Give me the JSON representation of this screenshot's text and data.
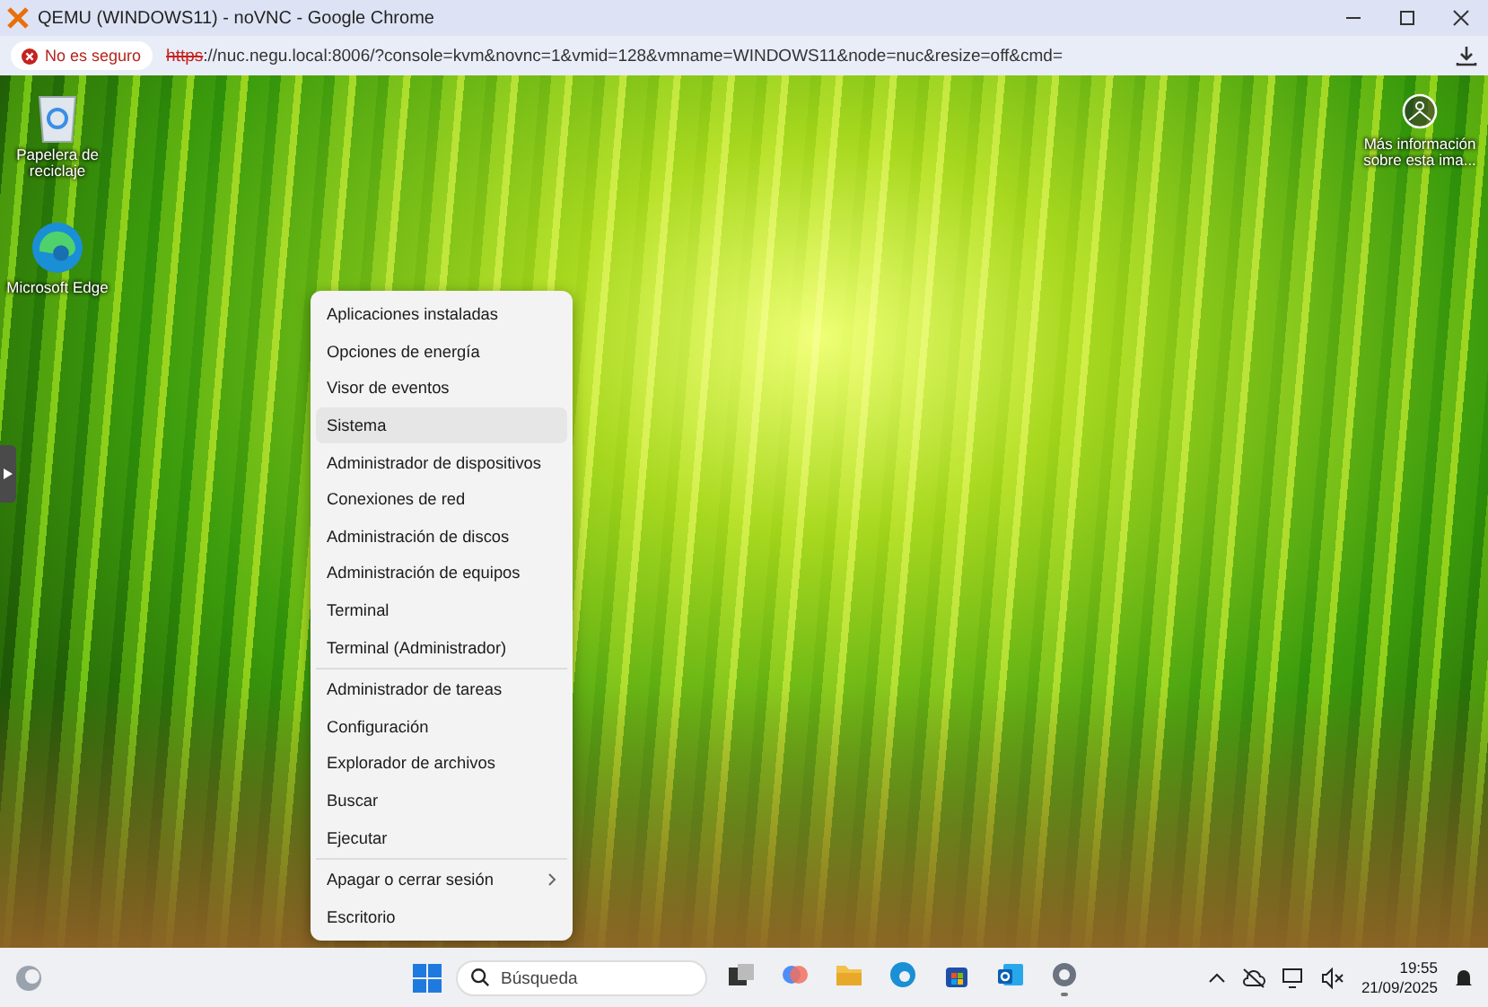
{
  "window": {
    "title": "QEMU (WINDOWS11) - noVNC - Google Chrome"
  },
  "address_bar": {
    "security": "No es seguro",
    "scheme": "https",
    "url": "://nuc.negu.local:8006/?console=kvm&novnc=1&vmid=128&vmname=WINDOWS11&node=nuc&resize=off&cmd="
  },
  "desktop_icons": [
    {
      "kind": "recycle",
      "label": "Papelera de reciclaje"
    },
    {
      "kind": "edge",
      "label": "Microsoft Edge"
    }
  ],
  "spotlight": {
    "label": "Más información sobre esta ima..."
  },
  "context_menu": {
    "groups": [
      [
        {
          "label": "Aplicaciones instaladas",
          "selected": false,
          "submenu": false
        },
        {
          "label": "Opciones de energía",
          "selected": false,
          "submenu": false
        },
        {
          "label": "Visor de eventos",
          "selected": false,
          "submenu": false
        },
        {
          "label": "Sistema",
          "selected": true,
          "submenu": false
        },
        {
          "label": "Administrador de dispositivos",
          "selected": false,
          "submenu": false
        },
        {
          "label": "Conexiones de red",
          "selected": false,
          "submenu": false
        },
        {
          "label": "Administración de discos",
          "selected": false,
          "submenu": false
        },
        {
          "label": "Administración de equipos",
          "selected": false,
          "submenu": false
        },
        {
          "label": "Terminal",
          "selected": false,
          "submenu": false
        },
        {
          "label": "Terminal (Administrador)",
          "selected": false,
          "submenu": false
        }
      ],
      [
        {
          "label": "Administrador de tareas",
          "selected": false,
          "submenu": false
        },
        {
          "label": "Configuración",
          "selected": false,
          "submenu": false
        },
        {
          "label": "Explorador de archivos",
          "selected": false,
          "submenu": false
        },
        {
          "label": "Buscar",
          "selected": false,
          "submenu": false
        },
        {
          "label": "Ejecutar",
          "selected": false,
          "submenu": false
        }
      ],
      [
        {
          "label": "Apagar o cerrar sesión",
          "selected": false,
          "submenu": true
        },
        {
          "label": "Escritorio",
          "selected": false,
          "submenu": false
        }
      ]
    ]
  },
  "taskbar": {
    "search_placeholder": "Búsqueda",
    "apps": [
      {
        "kind": "taskview",
        "running": false
      },
      {
        "kind": "copilot",
        "running": false
      },
      {
        "kind": "folder",
        "running": false
      },
      {
        "kind": "edge",
        "running": false
      },
      {
        "kind": "store",
        "running": false
      },
      {
        "kind": "outlook",
        "running": false
      },
      {
        "kind": "settings",
        "running": true
      }
    ],
    "time": "19:55",
    "date": "21/09/2025"
  }
}
